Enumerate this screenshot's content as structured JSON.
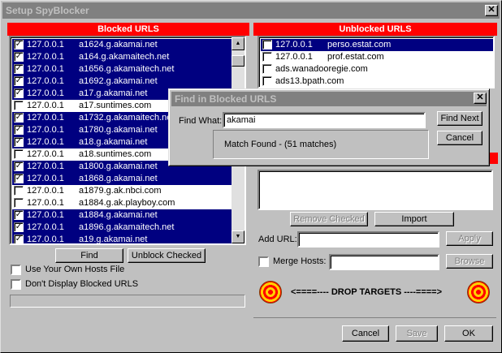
{
  "window": {
    "title": "Setup SpyBlocker",
    "close": "✕"
  },
  "blocked": {
    "header": "Blocked URLS",
    "rows": [
      {
        "checked": true,
        "selected": true,
        "ip": "127.0.0.1",
        "host": "a1624.g.akamai.net"
      },
      {
        "checked": true,
        "selected": true,
        "ip": "127.0.0.1",
        "host": "a164.g.akamaitech.net"
      },
      {
        "checked": true,
        "selected": true,
        "ip": "127.0.0.1",
        "host": "a1656.g.akamaitech.net"
      },
      {
        "checked": true,
        "selected": true,
        "ip": "127.0.0.1",
        "host": "a1692.g.akamai.net"
      },
      {
        "checked": true,
        "selected": true,
        "ip": "127.0.0.1",
        "host": "a17.g.akamai.net"
      },
      {
        "checked": false,
        "selected": false,
        "ip": "127.0.0.1",
        "host": "a17.suntimes.com"
      },
      {
        "checked": true,
        "selected": true,
        "ip": "127.0.0.1",
        "host": "a1732.g.akamaitech.net"
      },
      {
        "checked": true,
        "selected": true,
        "ip": "127.0.0.1",
        "host": "a1780.g.akamai.net"
      },
      {
        "checked": true,
        "selected": true,
        "ip": "127.0.0.1",
        "host": "a18.g.akamai.net"
      },
      {
        "checked": false,
        "selected": false,
        "ip": "127.0.0.1",
        "host": "a18.suntimes.com"
      },
      {
        "checked": true,
        "selected": true,
        "ip": "127.0.0.1",
        "host": "a1800.g.akamai.net"
      },
      {
        "checked": true,
        "selected": true,
        "ip": "127.0.0.1",
        "host": "a1868.g.akamai.net"
      },
      {
        "checked": false,
        "selected": false,
        "ip": "127.0.0.1",
        "host": "a1879.g.ak.nbci.com"
      },
      {
        "checked": false,
        "selected": false,
        "ip": "127.0.0.1",
        "host": "a1884.g.ak.playboy.com"
      },
      {
        "checked": true,
        "selected": true,
        "ip": "127.0.0.1",
        "host": "a1884.g.akamai.net"
      },
      {
        "checked": true,
        "selected": true,
        "ip": "127.0.0.1",
        "host": "a1896.g.akamaitech.net"
      },
      {
        "checked": true,
        "selected": true,
        "ip": "127.0.0.1",
        "host": "a19.g.akamai.net"
      }
    ],
    "find_label": "Find",
    "unblock_label": "Unblock Checked",
    "use_hosts_label": "Use Your Own Hosts File",
    "dont_display_label": "Don't Display Blocked URLS"
  },
  "unblocked": {
    "header": "Unblocked URLS",
    "rows": [
      {
        "checked": false,
        "selected": true,
        "ip": "127.0.0.1",
        "host": "perso.estat.com"
      },
      {
        "checked": false,
        "selected": false,
        "ip": "127.0.0.1",
        "host": "prof.estat.com"
      },
      {
        "checked": false,
        "selected": false,
        "ip": "",
        "host": "ads.wanadooregie.com"
      },
      {
        "checked": false,
        "selected": false,
        "ip": "",
        "host": "ads13.bpath.com"
      }
    ],
    "remove_label": "Remove Checked",
    "import_label": "Import",
    "add_url_label": "Add URL:",
    "apply_label": "Apply",
    "merge_label": "Merge Hosts:",
    "browse_label": "Browse",
    "drop_targets_label": "<====---- DROP TARGETS ----====>"
  },
  "footer": {
    "cancel": "Cancel",
    "save": "Save",
    "ok": "OK"
  },
  "find_dialog": {
    "title": "Find in Blocked URLS",
    "find_what_label": "Find What:",
    "find_what_value": "akamai",
    "status": "Match Found - (51 matches)",
    "find_next": "Find Next",
    "cancel": "Cancel",
    "close": "✕"
  }
}
